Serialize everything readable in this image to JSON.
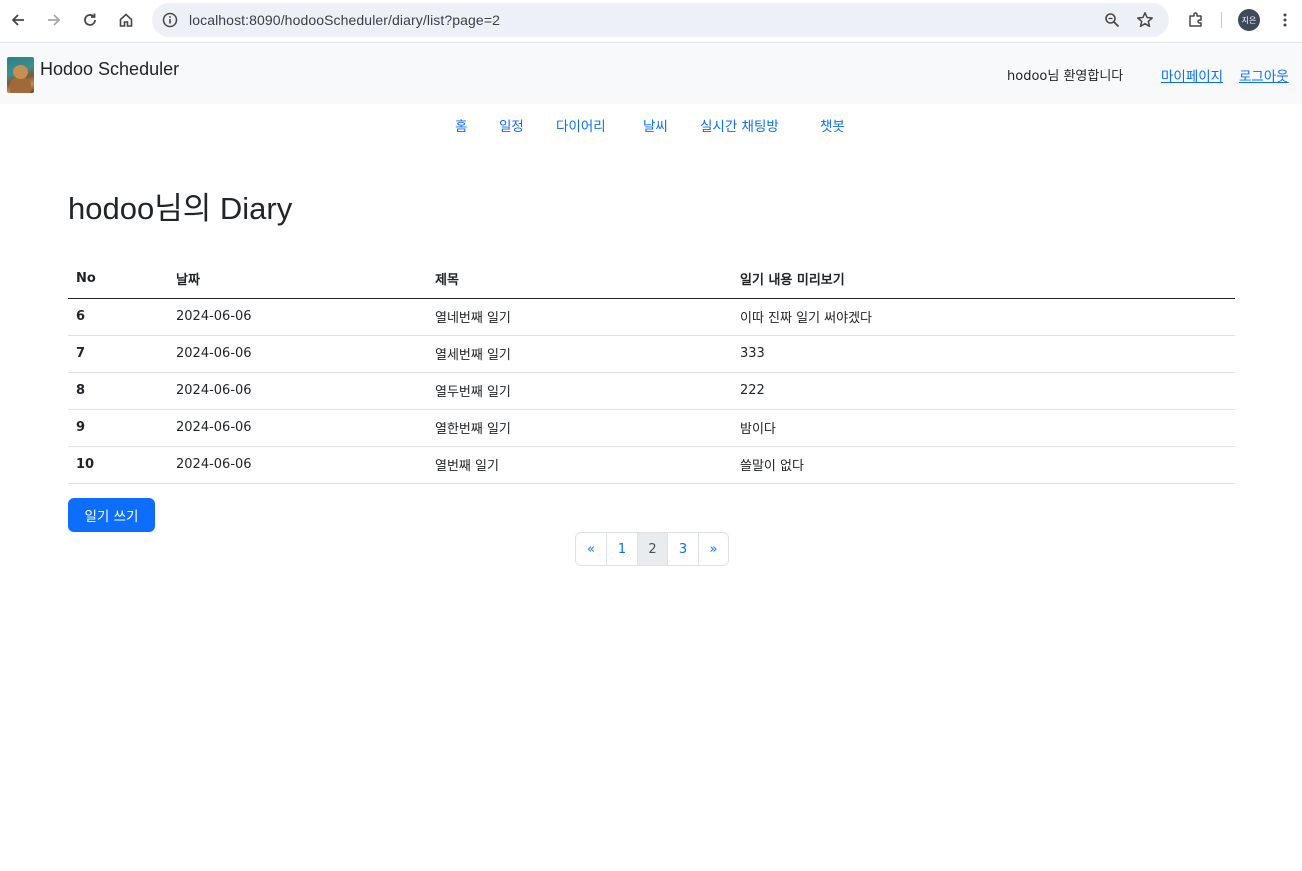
{
  "browser": {
    "url": "localhost:8090/hodooScheduler/diary/list?page=2",
    "profile_initials": "지은",
    "icons": [
      "back-arrow-icon",
      "forward-arrow-icon",
      "reload-icon",
      "home-icon",
      "site-info-icon",
      "zoom-icon",
      "bookmark-star-icon",
      "extensions-icon",
      "menu-dots-icon"
    ]
  },
  "header": {
    "brand": "Hodoo Scheduler",
    "welcome": "hodoo님 환영합니다",
    "mypage": "마이페이지",
    "logout": "로그아웃"
  },
  "nav": {
    "items": [
      "홈",
      "일정",
      "다이어리",
      "날씨",
      "실시간 채팅방",
      "챗봇"
    ]
  },
  "main": {
    "title": "hodoo님의 Diary",
    "table": {
      "headers": [
        "No",
        "날짜",
        "제목",
        "일기 내용 미리보기"
      ],
      "rows": [
        [
          "6",
          "2024-06-06",
          "열네번째 일기",
          "이따 진짜 일기 써야겠다"
        ],
        [
          "7",
          "2024-06-06",
          "열세번째 일기",
          "333"
        ],
        [
          "8",
          "2024-06-06",
          "열두번째 일기",
          "222"
        ],
        [
          "9",
          "2024-06-06",
          "열한번째 일기",
          "밤이다"
        ],
        [
          "10",
          "2024-06-06",
          "열번째 일기",
          "쓸말이 없다"
        ]
      ]
    },
    "write_button": "일기 쓰기",
    "pagination": {
      "prev": "«",
      "pages": [
        "1",
        "2",
        "3"
      ],
      "current": "2",
      "next": "»"
    }
  },
  "colors": {
    "primary": "#0d6efd",
    "header_bg": "#f8f9fa",
    "omnibox_bg": "#eef0f8"
  }
}
